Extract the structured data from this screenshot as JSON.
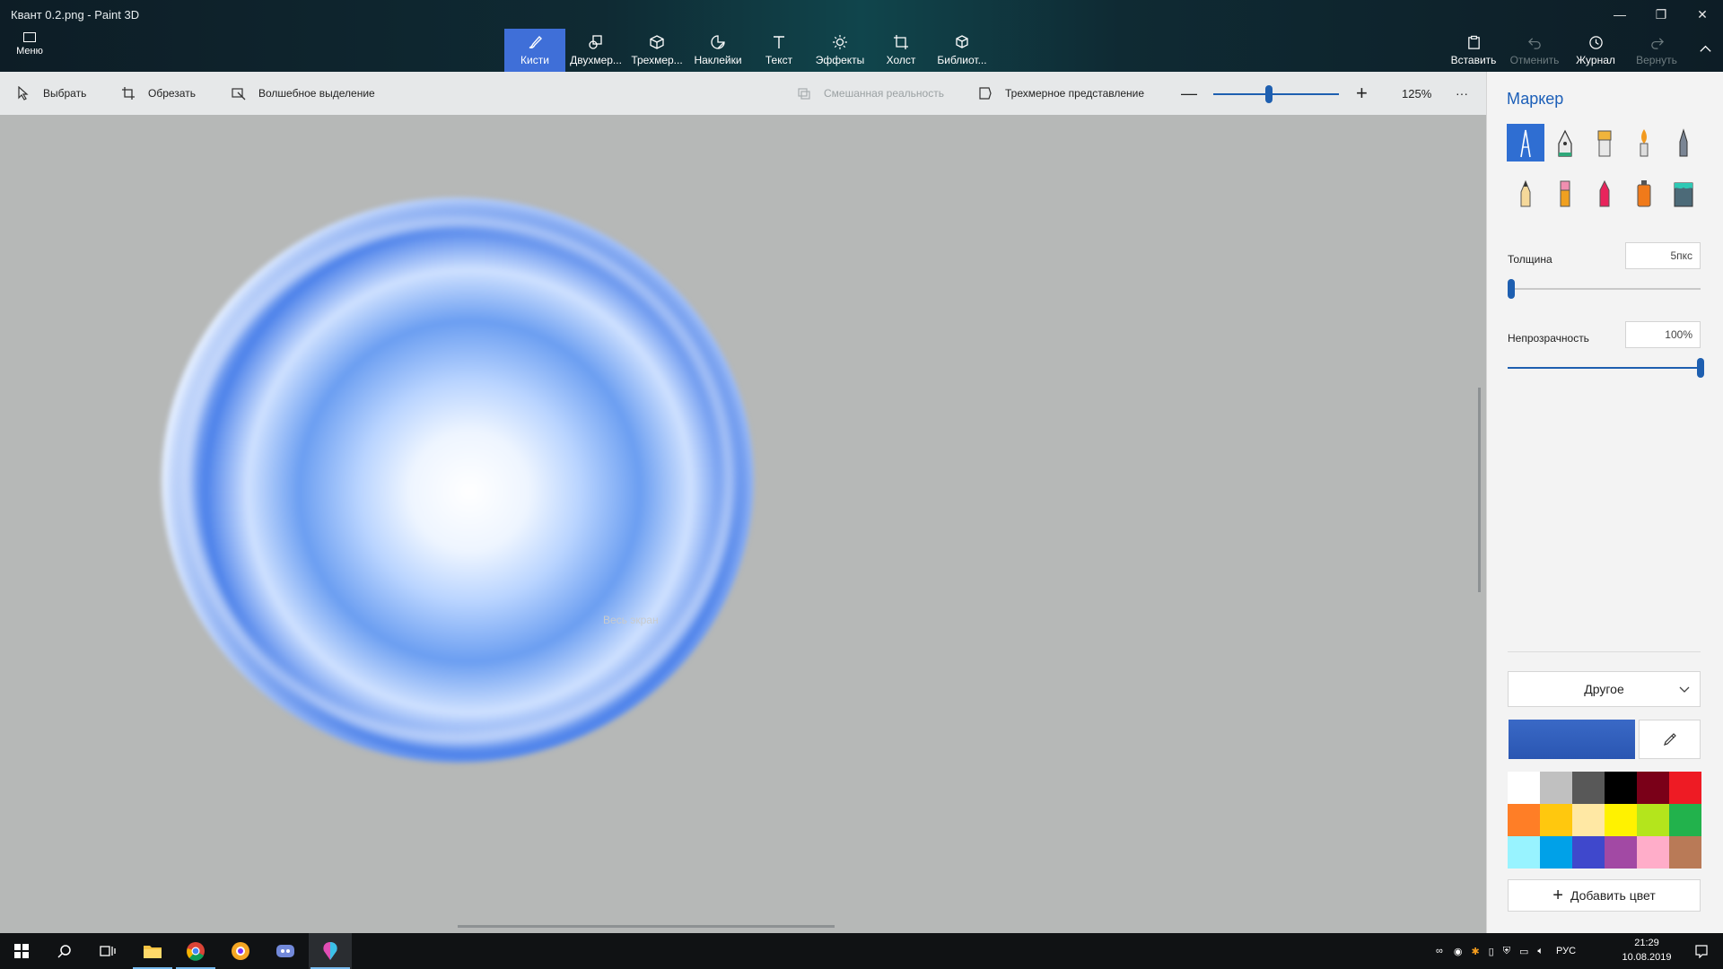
{
  "window": {
    "title": "Квант 0.2.png - Paint 3D",
    "menu_label": "Меню",
    "minimize": "—",
    "restore": "❐",
    "close": "✕"
  },
  "ribbon": {
    "tools": [
      {
        "label": "Кисти",
        "icon": "brush-icon",
        "active": true
      },
      {
        "label": "Двухмер...",
        "icon": "2d-shapes-icon"
      },
      {
        "label": "Трехмер...",
        "icon": "3d-shapes-icon"
      },
      {
        "label": "Наклейки",
        "icon": "stickers-icon"
      },
      {
        "label": "Текст",
        "icon": "text-icon"
      },
      {
        "label": "Эффекты",
        "icon": "effects-icon"
      },
      {
        "label": "Холст",
        "icon": "canvas-icon"
      },
      {
        "label": "Библиот...",
        "icon": "library-icon"
      }
    ],
    "right": [
      {
        "label": "Вставить",
        "icon": "paste-icon"
      },
      {
        "label": "Отменить",
        "icon": "undo-icon",
        "disabled": true
      },
      {
        "label": "Журнал",
        "icon": "history-icon"
      },
      {
        "label": "Вернуть",
        "icon": "redo-icon",
        "disabled": true
      }
    ],
    "collapse": "^"
  },
  "subbar": {
    "select": "Выбрать",
    "crop": "Обрезать",
    "magic_select": "Волшебное выделение",
    "mixed_reality": "Смешанная реальность",
    "view_3d": "Трехмерное представление",
    "zoom_out": "—",
    "zoom_in": "+",
    "zoom_level": "125%",
    "zoom_fraction": 0.44,
    "more": "···"
  },
  "canvas": {
    "watermark": "Весь экран"
  },
  "panel": {
    "title": "Маркер",
    "brushes": [
      "marker",
      "calligraphy-pen",
      "oil-brush",
      "watercolor",
      "pixel-pen",
      "pencil",
      "eraser",
      "crayon",
      "spray-can",
      "fill-bucket"
    ],
    "thickness_label": "Толщина",
    "thickness_value": "5пкс",
    "thickness_fraction": 0.02,
    "opacity_label": "Непрозрачность",
    "opacity_value": "100%",
    "opacity_fraction": 1.0,
    "color_dropdown": "Другое",
    "current_color": "#3a69c6",
    "palette": [
      "#ffffff",
      "#c0c0c0",
      "#585858",
      "#000000",
      "#7a0018",
      "#ee1b24",
      "#ff7e26",
      "#ffc80e",
      "#ffe8a4",
      "#fff200",
      "#b4e51c",
      "#22b24c",
      "#98f3ff",
      "#00a1e8",
      "#3f48cc",
      "#a249a4",
      "#ffadc9",
      "#b97a57"
    ],
    "add_color": "Добавить цвет"
  },
  "taskbar": {
    "lang": "РУС",
    "time": "21:29",
    "date": "10.08.2019"
  }
}
